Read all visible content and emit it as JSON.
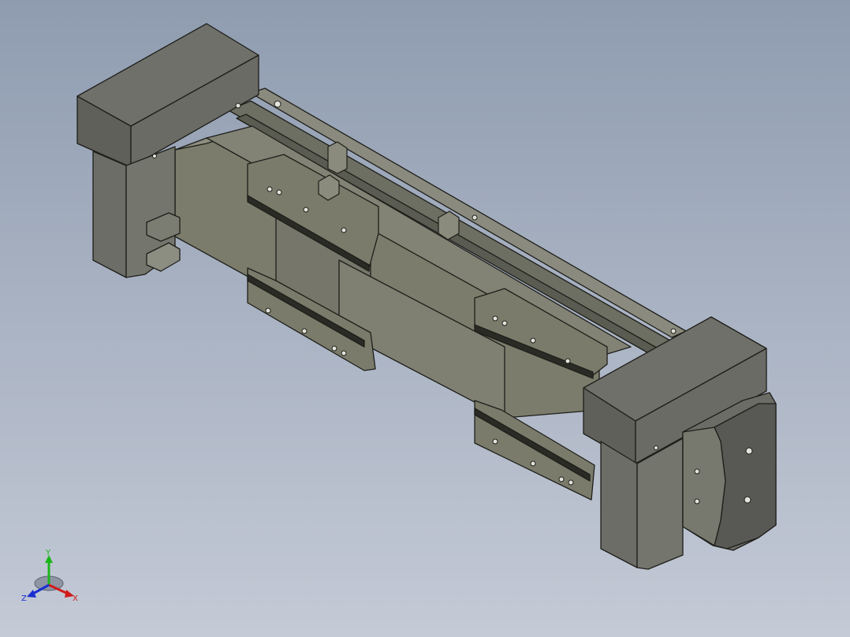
{
  "viewport": {
    "background_top": "#8f9cb0",
    "background_bottom": "#c4cad6"
  },
  "model": {
    "body_color": "#7b7c6b",
    "edge_color": "#1e1e1a",
    "cover_color": "#6f706a"
  },
  "triad": {
    "x_label": "X",
    "y_label": "Y",
    "z_label": "Z",
    "x_color": "#d11a1a",
    "y_color": "#1bb51b",
    "z_color": "#1a2fd1"
  }
}
